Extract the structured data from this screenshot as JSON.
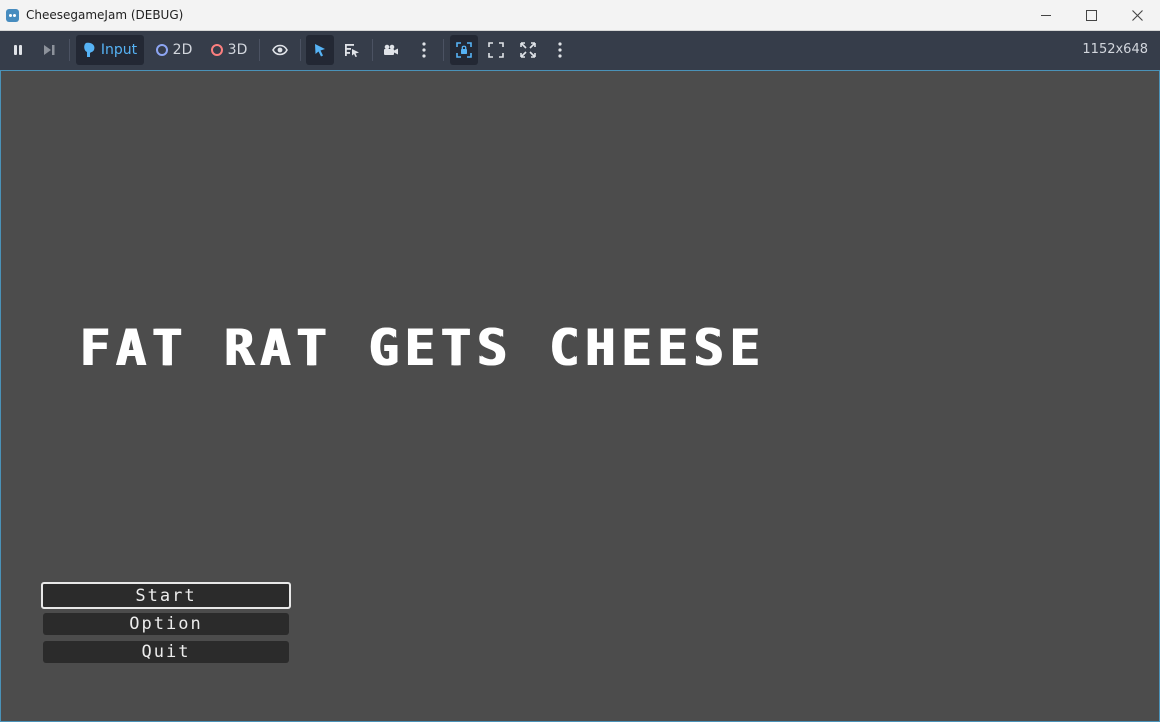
{
  "window": {
    "title": "CheesegameJam (DEBUG)"
  },
  "toolbar": {
    "input_label": "Input",
    "mode_2d_label": "2D",
    "mode_3d_label": "3D",
    "resolution": "1152x648",
    "colors": {
      "input_accent": "#56b3f5",
      "circle_2d": "#8da5f3",
      "circle_3d": "#fc7f7f"
    }
  },
  "game": {
    "title": "FAT RAT GETS CHEESE",
    "menu": {
      "start_label": "Start",
      "option_label": "Option",
      "quit_label": "Quit"
    },
    "background_color": "#4c4c4c"
  }
}
